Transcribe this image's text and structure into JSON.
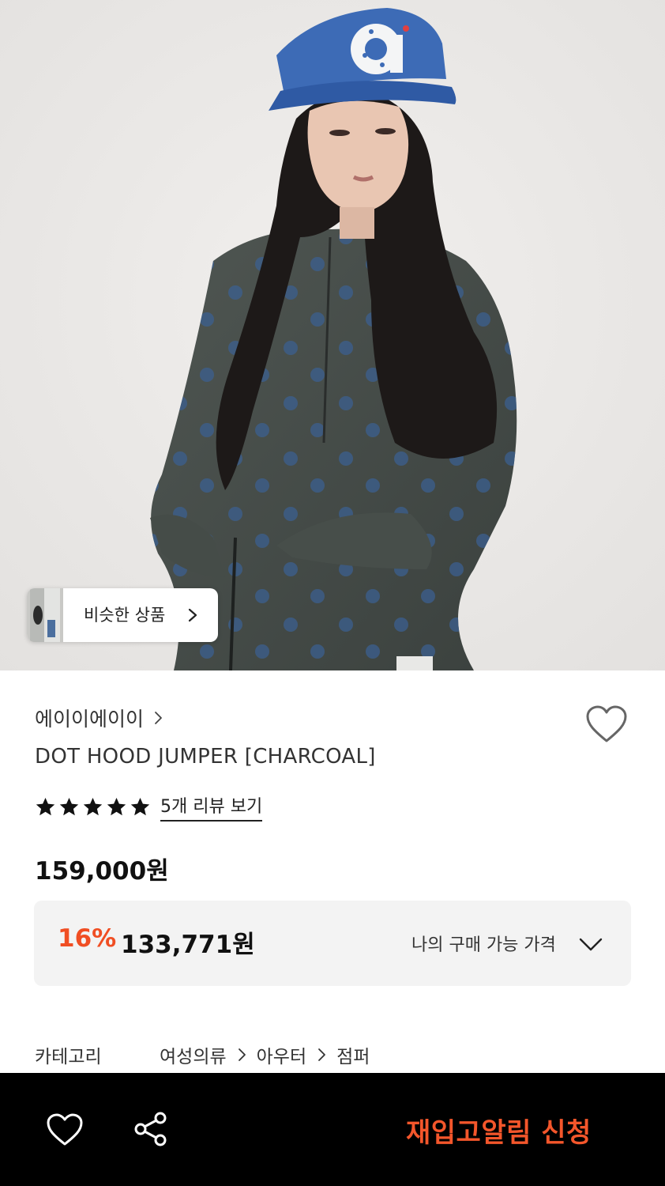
{
  "similar": {
    "label": "비슷한 상품"
  },
  "product": {
    "brand": "에이이에이이",
    "title": "DOT HOOD JUMPER [CHARCOAL]",
    "rating": 5,
    "rating_max": 5,
    "review_link": "5개 리뷰 보기",
    "price": "159,000원"
  },
  "benefit": {
    "discount_rate": "16%",
    "discounted_price": "133,771원",
    "label": "나의 구매 가능 가격"
  },
  "category": {
    "label": "카테고리",
    "path": [
      "여성의류",
      "아우터",
      "점퍼"
    ]
  },
  "bottom_bar": {
    "restock_label": "재입고알림 신청"
  },
  "colors": {
    "accent": "#f04e23",
    "restock": "#f4562b",
    "bottom_bar_bg": "#000000",
    "benefit_bg": "#f3f3f3"
  },
  "icons": {
    "like": "heart-outline-icon",
    "share": "share-icon",
    "chevron": "chevron-right-icon",
    "expand": "chevron-down-icon",
    "star": "star-icon"
  }
}
